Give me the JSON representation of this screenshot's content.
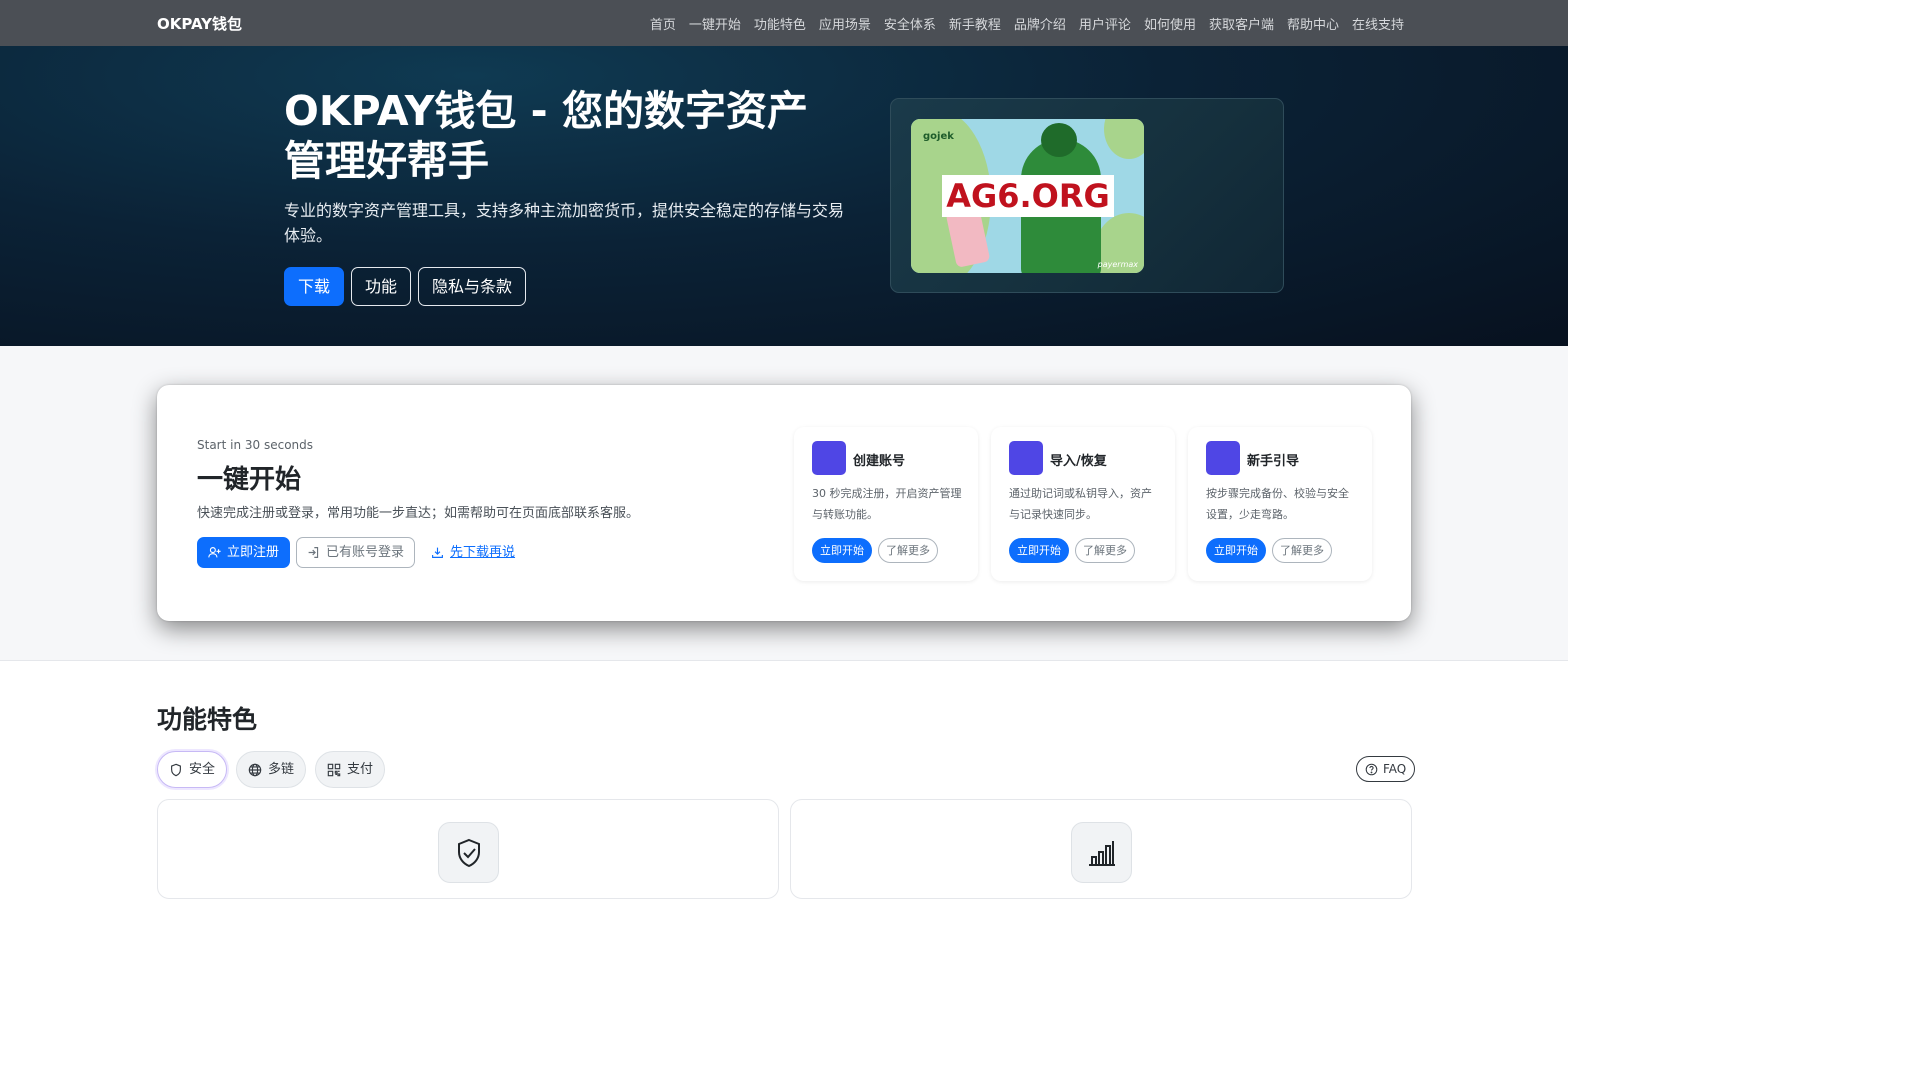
{
  "navbar": {
    "brand": "OKPAY钱包",
    "links": [
      "首页",
      "一键开始",
      "功能特色",
      "应用场景",
      "安全体系",
      "新手教程",
      "品牌介绍",
      "用户评论",
      "如何使用",
      "获取客户端",
      "帮助中心",
      "在线支持"
    ]
  },
  "hero": {
    "title": "OKPAY钱包 - 您的数字资产管理好帮手",
    "description": "专业的数字资产管理工具，支持多种主流加密货币，提供安全稳定的存储与交易体验。",
    "buttons": {
      "download": "下载",
      "features": "功能",
      "privacy": "隐私与条款"
    },
    "promo": {
      "brand": "gojek",
      "watermark": "AG6.ORG",
      "footer": "payermax"
    }
  },
  "quick_start": {
    "subtitle": "Start in 30 seconds",
    "title": "一键开始",
    "description": "快速完成注册或登录，常用功能一步直达；如需帮助可在页面底部联系客服。",
    "buttons": {
      "register": "立即注册",
      "login": "已有账号登录",
      "download_first": "先下载再说"
    },
    "cards": [
      {
        "title": "创建账号",
        "description": "30 秒完成注册，开启资产管理与转账功能。",
        "start": "立即开始",
        "more": "了解更多"
      },
      {
        "title": "导入/恢复",
        "description": "通过助记词或私钥导入，资产与记录快速同步。",
        "start": "立即开始",
        "more": "了解更多"
      },
      {
        "title": "新手引导",
        "description": "按步骤完成备份、校验与安全设置，少走弯路。",
        "start": "立即开始",
        "more": "了解更多"
      }
    ]
  },
  "features": {
    "title": "功能特色",
    "tabs": [
      "安全",
      "多链",
      "支付"
    ],
    "faq": "FAQ"
  },
  "colors": {
    "primary": "#0d6efd",
    "accent_square": "#4f46e5",
    "navbar": "#4b4f55"
  }
}
